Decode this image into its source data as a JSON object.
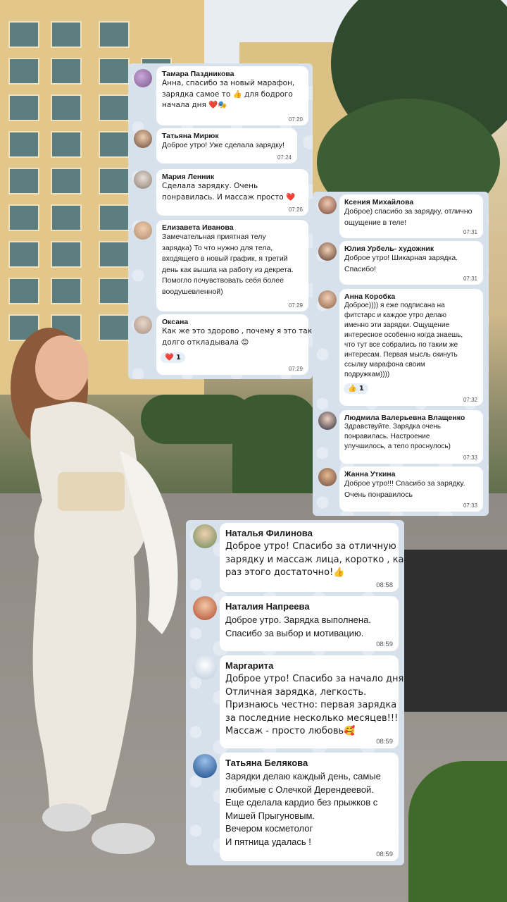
{
  "panel1": {
    "messages": [
      {
        "name": "Тамара Паздникова",
        "lines": [
          "Анна, спасибо за новый марафон,",
          "зарядка самое то 👍 для бодрого",
          "начала дня ❤️🎭"
        ],
        "time": "07:20"
      },
      {
        "name": "Татьяна Мирюк",
        "lines": [
          "Доброе утро! Уже сделала зарядку!"
        ],
        "time": "07:24"
      },
      {
        "name": "Мария Ленник",
        "lines": [
          "Сделала зарядку. Очень",
          "понравилась. И массаж просто ❤️"
        ],
        "time": "07:26"
      },
      {
        "name": "Елизавета Иванова",
        "lines": [
          "Замечательная приятная телу",
          "зарядка) То что нужно для тела,",
          "входящего в новый график, я третий",
          "день как вышла на работу из декрета.",
          "Помогло почувствовать себя более",
          "воодушевленной)"
        ],
        "time": "07:29"
      },
      {
        "name": "Оксана",
        "lines": [
          "Как же это здорово , почему я это так",
          "долго откладывала 😊"
        ],
        "reaction": "❤️ 1",
        "time": "07:29"
      }
    ]
  },
  "panel2": {
    "messages": [
      {
        "name": "Ксения Михайлова",
        "lines": [
          "Доброе) спасибо за зарядку, отлично",
          "ощущение в теле!"
        ],
        "time": "07:31"
      },
      {
        "name": "Юлия Урбель- художник",
        "lines": [
          "Доброе утро! Шикарная зарядка.",
          "Спасибо!"
        ],
        "time": "07:31"
      },
      {
        "name": "Анна Коробка",
        "lines": [
          "Доброе)))) я еже подписана на",
          "фитстарс и каждое утро делаю",
          "именно эти зарядки. Ощущение",
          "интересное особенно когда знаешь,",
          "что тут все собрались по таким же",
          "интересам. Первая мысль скинуть",
          "ссылку марафона своим",
          "подружкам))))"
        ],
        "reaction": "👍 1",
        "time": "07:32"
      },
      {
        "name": "Людмила Валерьевна Влащенко",
        "lines": [
          "Здравствуйте. Зарядка очень",
          "понравилась. Настроение",
          "улучшилось, а тело проснулось)"
        ],
        "time": "07:33"
      },
      {
        "name": "Жанна Уткина",
        "lines": [
          "Доброе утро!!! Спасибо за зарядку.",
          "Очень понравилось"
        ],
        "time": "07:33"
      }
    ]
  },
  "panel3": {
    "messages": [
      {
        "name": "Наталья Филинова",
        "lines": [
          "Доброе утро! Спасибо за отличную",
          "зарядку и массаж лица, коротко , как",
          "раз этого достаточно!👍"
        ],
        "time": "08:58"
      },
      {
        "name": "Наталия Напреева",
        "lines": [
          "Доброе утро. Зарядка выполнена.",
          "Спасибо за выбор и мотивацию."
        ],
        "time": "08:59"
      },
      {
        "name": "Маргарита",
        "lines": [
          "Доброе утро! Спасибо за начало дня!",
          "Отличная зарядка, легкость.",
          "Признаюсь честно: первая зарядка",
          "за последние несколько месяцев!!!",
          "Массаж - просто любовь🥰"
        ],
        "time": "08:59"
      },
      {
        "name": "Татьяна Белякова",
        "lines": [
          "Зарядки делаю каждый день, самые",
          "любимые с Олечкой Дерендеевой.",
          "Еще сделала кардио без прыжков с",
          "Мишей Прыгуновым.",
          "Вечером косметолог",
          "И пятница удалась !"
        ],
        "time": "08:59"
      }
    ]
  }
}
